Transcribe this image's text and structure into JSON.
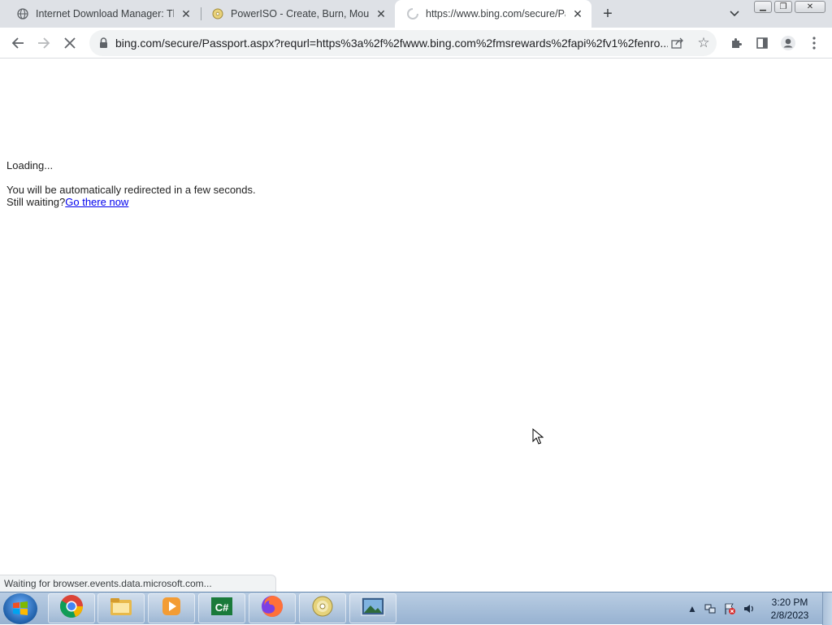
{
  "browser": {
    "tabs": [
      {
        "title": "Internet Download Manager: The",
        "favicon": "globe-icon",
        "active": false
      },
      {
        "title": "PowerISO - Create, Burn, Mount,",
        "favicon": "disc-icon",
        "active": false
      },
      {
        "title": "https://www.bing.com/secure/Pa",
        "favicon": "loading-spinner-icon",
        "active": true
      }
    ],
    "address_bar": {
      "url": "bing.com/secure/Passport.aspx?requrl=https%3a%2f%2fwww.bing.com%2fmsrewards%2fapi%2fv1%2fenro..."
    }
  },
  "page": {
    "loading_text": "Loading...",
    "redirect_text": "You will be automatically redirected in a few seconds.",
    "still_waiting_text": "Still waiting?",
    "go_link_text": "Go there now"
  },
  "status_bar": {
    "text": "Waiting for browser.events.data.microsoft.com..."
  },
  "taskbar": {
    "apps": [
      "chrome-icon",
      "file-explorer-icon",
      "media-player-icon",
      "csharp-icon",
      "firefox-icon",
      "poweriso-disc-icon",
      "photo-viewer-icon"
    ],
    "clock": {
      "time": "3:20 PM",
      "date": "2/8/2023"
    }
  },
  "colors": {
    "tabstrip_bg": "#dee1e6",
    "link": "#0000ee",
    "taskbar": "#a8c0dc"
  }
}
